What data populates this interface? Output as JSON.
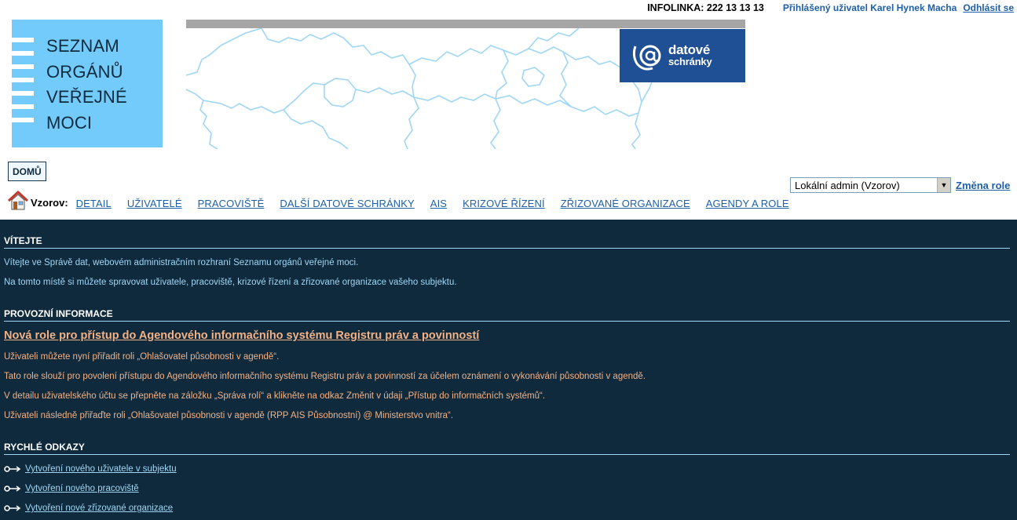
{
  "topbar": {
    "infolinka": "INFOLINKA: 222 13 13 13",
    "logged_user": "Přihlášený uživatel Karel Hynek Macha",
    "logout": "Odhlásit se"
  },
  "logo": {
    "text": "SEZNAM\nORGÁNŮ\nVEŘEJNÉ\nMOCI",
    "bg_color": "#72cbfa"
  },
  "datove_schranky": {
    "line1": "datové",
    "line2": "schránky",
    "bg_color": "#1f4f94"
  },
  "home_button": "DOMŮ",
  "role": {
    "selected": "Lokální admin (Vzorov)",
    "change_link": "Změna role"
  },
  "nav": {
    "prefix": "Vzorov:",
    "items": [
      "DETAIL",
      "UŽIVATELÉ",
      "PRACOVIŠTĚ",
      "DALŠÍ DATOVÉ SCHRÁNKY",
      "AIS",
      "KRIZOVÉ ŘÍZENÍ",
      "ZŘIZOVANÉ ORGANIZACE",
      "AGENDY A ROLE"
    ]
  },
  "welcome": {
    "title": "VÍTEJTE",
    "lines": [
      "Vítejte ve Správě dat, webovém administračním rozhraní Seznamu orgánů veřejné moci.",
      "Na tomto místě si můžete spravovat uživatele, pracoviště, krizové řízení a zřizované organizace vašeho subjektu."
    ]
  },
  "operational": {
    "title": "PROVOZNÍ INFORMACE",
    "headline": "Nová role pro přístup do Agendového informačního systému Registru práv a povinností",
    "lines": [
      "Uživateli můžete nyní přiřadit roli „Ohlašovatel působnosti v agendě“.",
      "Tato role slouží pro povolení přístupu do Agendového informačního systému Registru práv a povinností za účelem oznámení o vykonávání působnosti v agendě.",
      "V detailu uživatelského účtu se přepněte na záložku „Správa rolí“ a klikněte na odkaz Změnit v údaji „Přístup do informačních systémů“.",
      "Uživateli následně přiřaďte roli „Ohlašovatel působnosti v agendě (RPP AIS Působnostní) @ Ministerstvo vnitra“."
    ]
  },
  "quick_links": {
    "title": "RYCHLÉ ODKAZY",
    "items": [
      "Vytvoření nového uživatele v subjektu",
      "Vytvoření nového pracoviště",
      "Vytvoření nové zřizované organizace"
    ],
    "icon": "key-arrow-icon"
  },
  "colors": {
    "content_bg": "#0f2a3d",
    "link_blue": "#1e5fa8",
    "text_cyan": "#9fd6f5",
    "text_orange": "#f4b184"
  }
}
